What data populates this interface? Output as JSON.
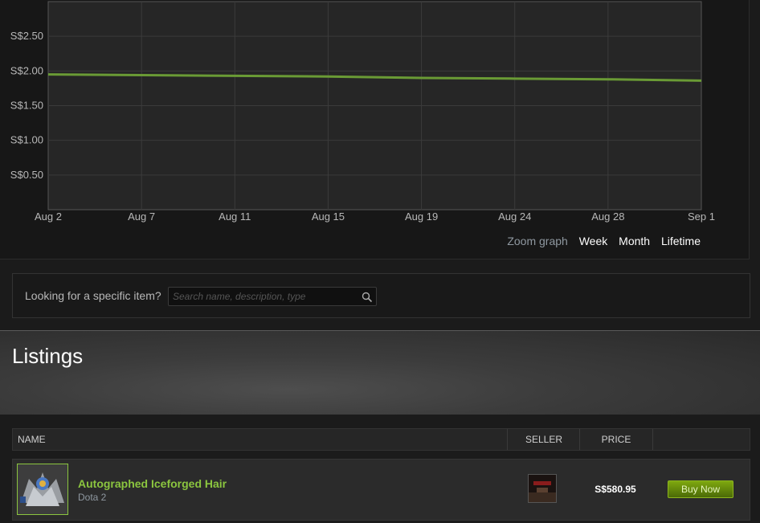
{
  "chart_data": {
    "type": "line",
    "x": [
      "Aug 2",
      "Aug 7",
      "Aug 11",
      "Aug 15",
      "Aug 19",
      "Aug 24",
      "Aug 28",
      "Sep 1"
    ],
    "series": [
      {
        "values": [
          1.95,
          1.94,
          1.93,
          1.92,
          1.9,
          1.89,
          1.88,
          1.86
        ]
      }
    ],
    "y_ticks": [
      "S$0.50",
      "S$1.00",
      "S$1.50",
      "S$2.00",
      "S$2.50"
    ],
    "y_tick_values": [
      0.5,
      1.0,
      1.5,
      2.0,
      2.5
    ],
    "ylim": [
      0,
      3.0
    ],
    "grid": true,
    "line_color": "#6a9b35",
    "title": "",
    "xlabel": "",
    "ylabel": ""
  },
  "zoom": {
    "label": "Zoom graph",
    "options": [
      "Week",
      "Month",
      "Lifetime"
    ]
  },
  "search": {
    "label": "Looking for a specific item?",
    "placeholder": "Search name, description, type"
  },
  "listings": {
    "title": "Listings",
    "columns": {
      "name": "NAME",
      "seller": "SELLER",
      "price": "PRICE"
    },
    "rows": [
      {
        "name": "Autographed Iceforged Hair",
        "game": "Dota 2",
        "price": "S$580.95",
        "action": "Buy Now"
      }
    ]
  },
  "colors": {
    "accent_green": "#8bc53f",
    "background": "#1b1b1b"
  }
}
